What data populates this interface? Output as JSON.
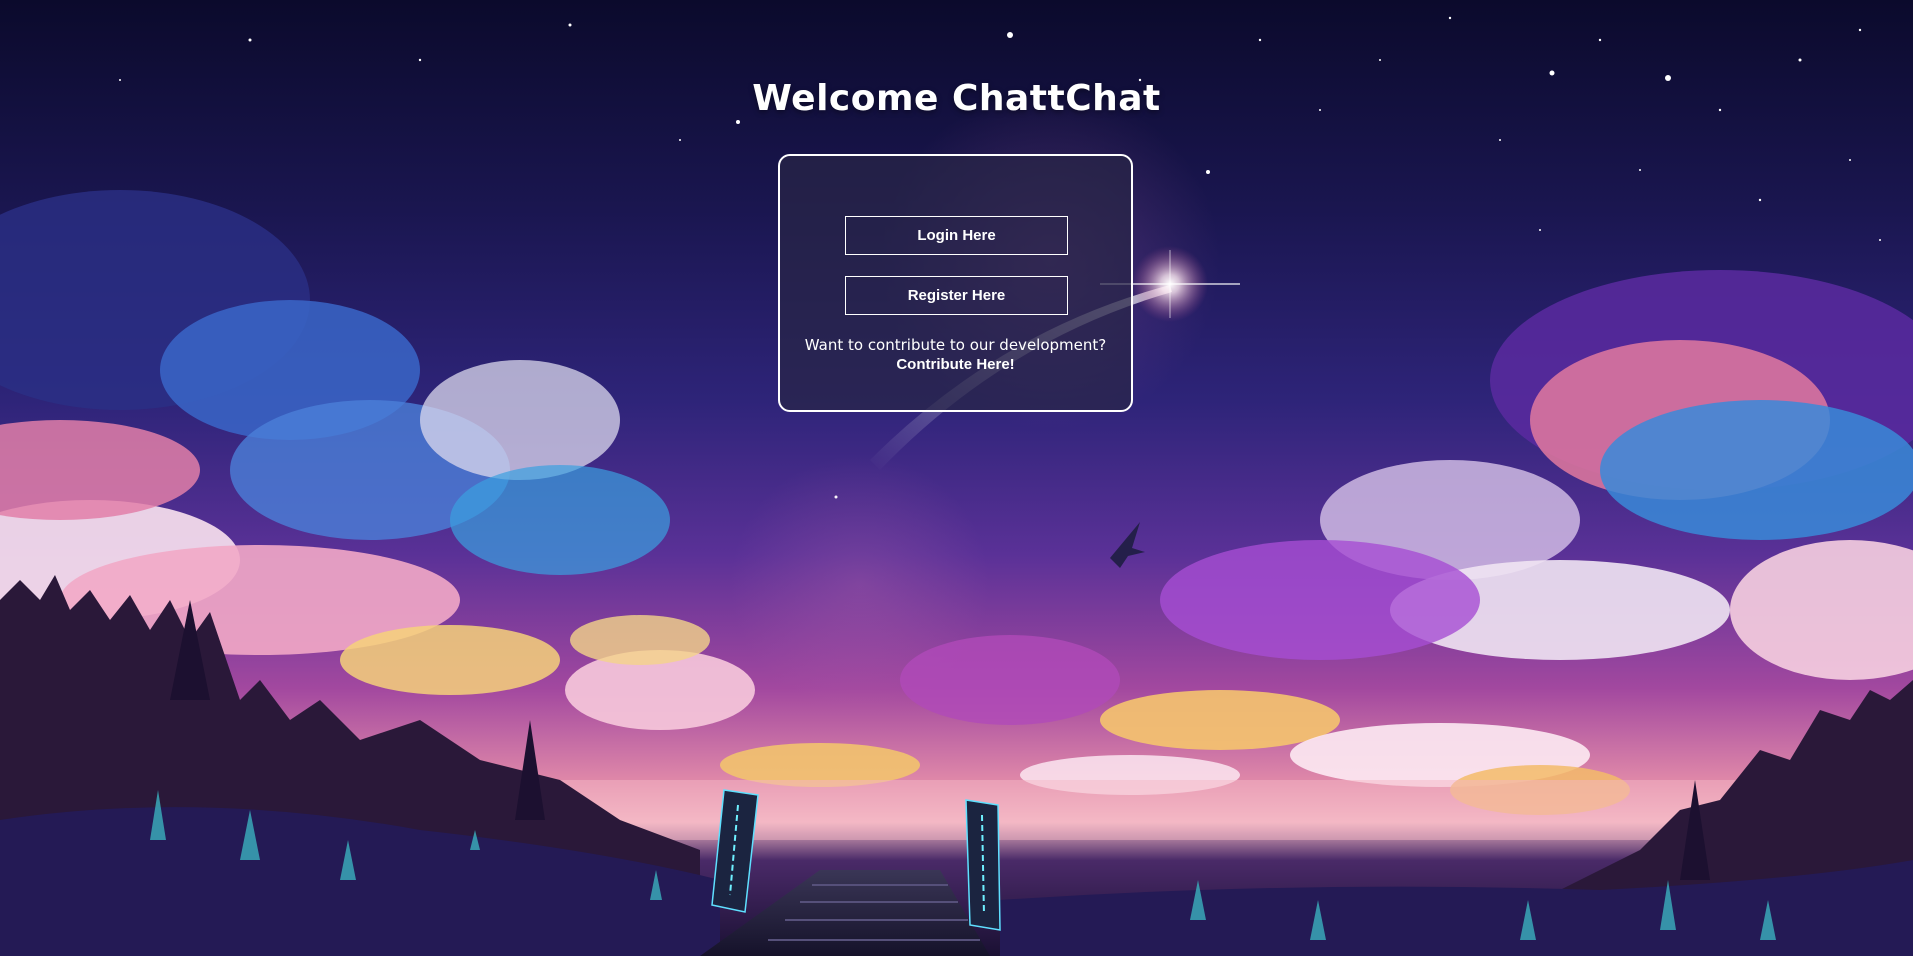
{
  "page": {
    "title": "Welcome ChattChat"
  },
  "auth_card": {
    "login_label": "Login Here",
    "register_label": "Register Here",
    "contribute_prompt": "Want to contribute to our development?",
    "contribute_link": "Contribute Here!"
  },
  "colors": {
    "text": "#ffffff",
    "card_background": "#282646",
    "card_border": "#ffffff",
    "sky_top": "#0b0a2c",
    "sky_horizon": "#f4b8c4"
  },
  "background": {
    "description_icon": "night-sky-landscape-icon"
  }
}
